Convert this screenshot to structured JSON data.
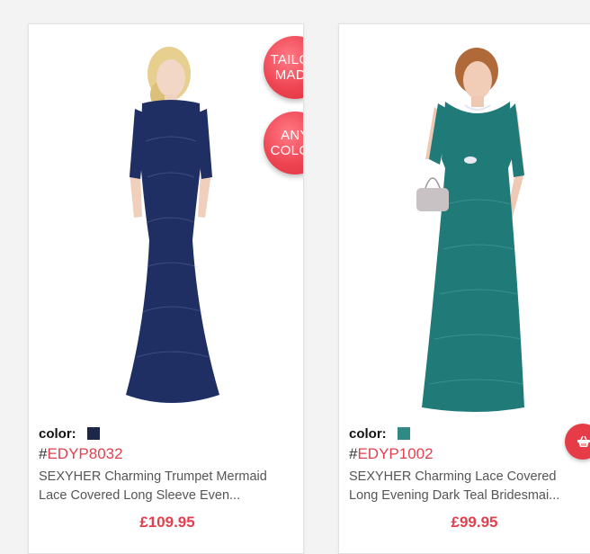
{
  "products": [
    {
      "color_label": "color:",
      "swatch_color": "#1d2748",
      "sku_prefix": "#",
      "sku_code": "EDYP8032",
      "title_line1": "SEXYHER Charming Trumpet Mermaid",
      "title_line2": "Lace Covered Long Sleeve Even...",
      "price": "£109.95",
      "dress_color": "#1f2f63",
      "badges": [
        "TAILOR\nMADE",
        "ANY\nCOLOR"
      ]
    },
    {
      "color_label": "color:",
      "swatch_color": "#2f8a86",
      "sku_prefix": "#",
      "sku_code": "EDYP1002",
      "title_line1": "SEXYHER Charming Lace Covered",
      "title_line2": "Long Evening Dark Teal Bridesmai...",
      "price": "£99.95",
      "dress_color": "#1f7a78"
    }
  ],
  "cart_button": {
    "icon": "shopping-basket-icon",
    "color": "#e63c47"
  },
  "accent_color": "#e0414e"
}
